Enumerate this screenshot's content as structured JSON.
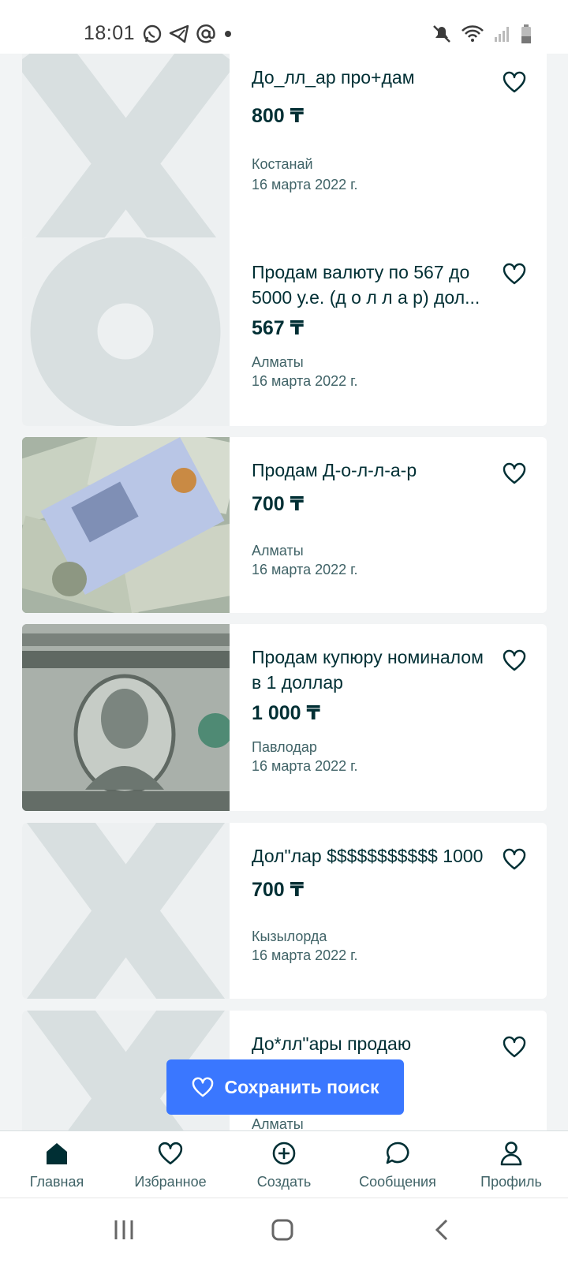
{
  "status": {
    "time": "18:01",
    "left_icons": [
      "whatsapp-icon",
      "telegram-icon",
      "at-icon",
      "dot-icon"
    ],
    "right_icons": [
      "mute-icon",
      "wifi-icon",
      "signal-icon",
      "battery-icon"
    ]
  },
  "listings": [
    {
      "title": "До_лл_ар про+дам",
      "price": "800 ₸",
      "city": "Костанай",
      "date": "16 марта 2022 г.",
      "thumb": "placeholder-x"
    },
    {
      "title": "Продам валюту по 567 до 5000 у.е. (д о л л а р) дол...",
      "price": "567 ₸",
      "city": "Алматы",
      "date": "16 марта 2022 г.",
      "thumb": "placeholder-o"
    },
    {
      "title": "Продам Д-о-л-л-а-р",
      "price": "700 ₸",
      "city": "Алматы",
      "date": "16 марта 2022 г.",
      "thumb": "banknotes-photo"
    },
    {
      "title": "Продам купюру номиналом в 1 доллар",
      "price": "1 000 ₸",
      "city": "Павлодар",
      "date": "16 марта 2022 г.",
      "thumb": "one-dollar-photo"
    },
    {
      "title": "Дол\"лар $$$$$$$$$$$ 1000",
      "price": "700 ₸",
      "city": "Кызылорда",
      "date": "16 марта 2022 г.",
      "thumb": "placeholder-x"
    },
    {
      "title": "До*лл\"ары продаю",
      "price": "",
      "city": "Алматы",
      "date": "",
      "thumb": "placeholder-x"
    }
  ],
  "save_search": {
    "label": "Сохранить поиск"
  },
  "bottom_nav": [
    {
      "label": "Главная",
      "icon": "home-icon"
    },
    {
      "label": "Избранное",
      "icon": "heart-icon"
    },
    {
      "label": "Создать",
      "icon": "plus-circle-icon"
    },
    {
      "label": "Сообщения",
      "icon": "chat-icon"
    },
    {
      "label": "Профиль",
      "icon": "profile-icon"
    }
  ],
  "colors": {
    "accent": "#3a77ff",
    "text": "#002f34",
    "muted": "#406367",
    "placeholder": "#d8dfe0"
  }
}
